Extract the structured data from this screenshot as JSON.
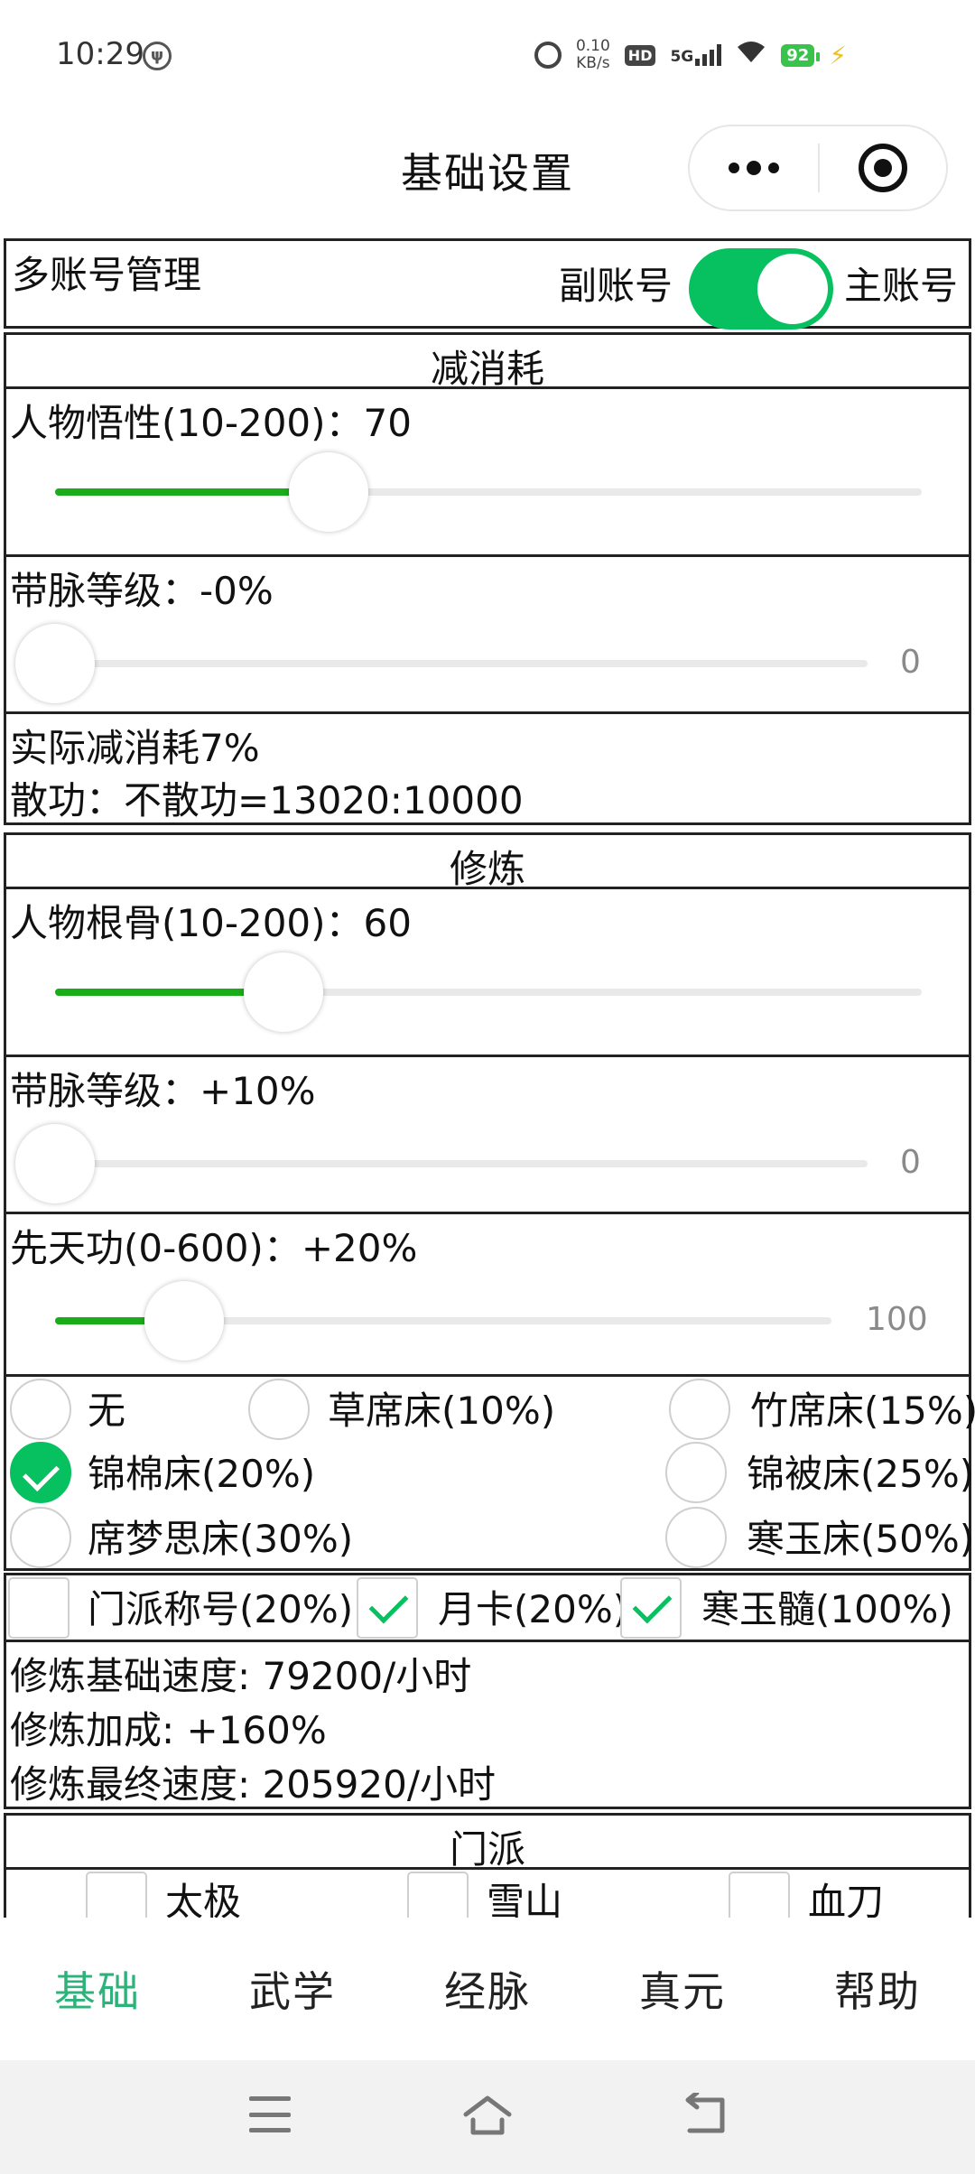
{
  "status_bar": {
    "time": "10:29",
    "speed_value": "0.10",
    "speed_unit": "KB/s",
    "hd_label": "HD",
    "network_label": "5G",
    "battery": "92"
  },
  "header": {
    "title": "基础设置"
  },
  "account": {
    "label": "多账号管理",
    "left_label": "副账号",
    "right_label": "主账号",
    "toggle_on": true
  },
  "reduce": {
    "section_title": "减消耗",
    "wisdom": {
      "label": "人物悟性(10-200)：70",
      "value": 70,
      "min": 10,
      "max": 200
    },
    "meridian": {
      "label": "带脉等级：-0%",
      "value": 0,
      "display": "0"
    },
    "result_line1": "实际减消耗7%",
    "result_line2": "散功：不散功=13020:10000"
  },
  "cultivation": {
    "section_title": "修炼",
    "root": {
      "label": "人物根骨(10-200)：60",
      "value": 60,
      "min": 10,
      "max": 200
    },
    "meridian": {
      "label": "带脉等级：+10%",
      "value": 0,
      "display": "0"
    },
    "innate": {
      "label": "先天功(0-600)：+20%",
      "value": 100,
      "min": 0,
      "max": 600,
      "display": "100"
    },
    "beds": [
      {
        "label": "无",
        "checked": false
      },
      {
        "label": "草席床(10%)",
        "checked": false
      },
      {
        "label": "竹席床(15%)",
        "checked": false
      },
      {
        "label": "锦棉床(20%)",
        "checked": true
      },
      {
        "label": "锦被床(25%)",
        "checked": false
      },
      {
        "label": "席梦思床(30%)",
        "checked": false
      },
      {
        "label": "寒玉床(50%)",
        "checked": false
      }
    ],
    "bonuses": [
      {
        "label": "门派称号(20%)",
        "checked": false
      },
      {
        "label": "月卡(20%)",
        "checked": true
      },
      {
        "label": "寒玉髓(100%)",
        "checked": true
      }
    ],
    "summary": [
      "修炼基础速度: 79200/小时",
      "修炼加成: +160%",
      "修炼最终速度: 205920/小时"
    ]
  },
  "sect": {
    "section_title": "门派",
    "options": [
      {
        "label": "太极",
        "checked": false
      },
      {
        "label": "雪山",
        "checked": false
      },
      {
        "label": "血刀",
        "checked": false
      }
    ]
  },
  "tabs": [
    "基础",
    "武学",
    "经脉",
    "真元",
    "帮助"
  ],
  "colors": {
    "accent_green": "#07c160",
    "slider_fill": "#1aad19",
    "active_tab": "#2db27a"
  }
}
